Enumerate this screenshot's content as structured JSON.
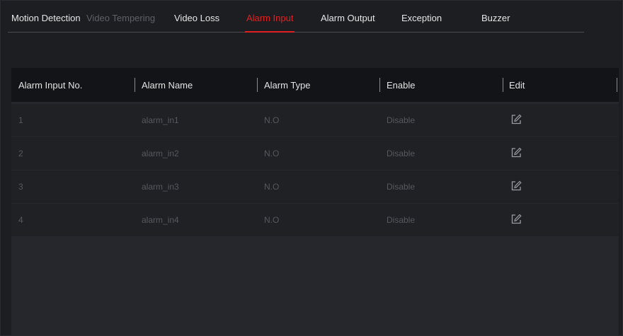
{
  "tabs": [
    {
      "label": "Motion Detection",
      "state": "normal"
    },
    {
      "label": "Video Tempering",
      "state": "disabled"
    },
    {
      "label": "Video Loss",
      "state": "normal"
    },
    {
      "label": "Alarm Input",
      "state": "active"
    },
    {
      "label": "Alarm Output",
      "state": "normal"
    },
    {
      "label": "Exception",
      "state": "normal"
    },
    {
      "label": "Buzzer",
      "state": "normal"
    }
  ],
  "table": {
    "columns": [
      "Alarm Input No.",
      "Alarm Name",
      "Alarm Type",
      "Enable",
      "Edit"
    ],
    "rows": [
      {
        "no": "1",
        "name": "alarm_in1",
        "type": "N.O",
        "enable": "Disable",
        "edit_icon": "edit-icon"
      },
      {
        "no": "2",
        "name": "alarm_in2",
        "type": "N.O",
        "enable": "Disable",
        "edit_icon": "edit-icon"
      },
      {
        "no": "3",
        "name": "alarm_in3",
        "type": "N.O",
        "enable": "Disable",
        "edit_icon": "edit-icon"
      },
      {
        "no": "4",
        "name": "alarm_in4",
        "type": "N.O",
        "enable": "Disable",
        "edit_icon": "edit-icon"
      }
    ]
  },
  "colors": {
    "background": "#1d1e22",
    "accent": "#e02020",
    "header_bg": "#131418",
    "row_bg": "#202125",
    "muted_text": "#56585e"
  }
}
